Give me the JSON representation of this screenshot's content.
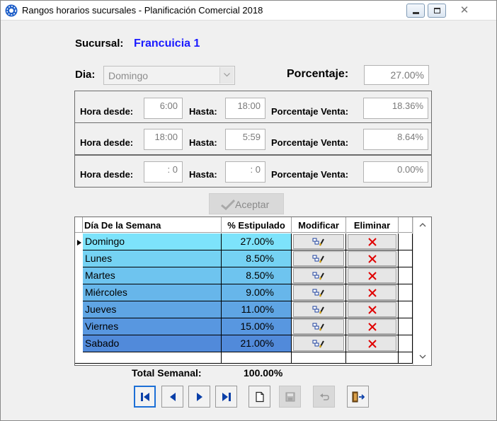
{
  "window": {
    "title": "Rangos horarios sucursales  -  Planificación Comercial 2018",
    "close_glyph": "✕"
  },
  "branch": {
    "label": "Sucursal:",
    "value": "Francuicia 1"
  },
  "day": {
    "label": "Dia:",
    "value": "Domingo"
  },
  "percentage": {
    "label": "Porcentaje:",
    "value": "27.00%"
  },
  "ranges": [
    {
      "from_label": "Hora desde:",
      "from": "6:00",
      "to_label": "Hasta:",
      "to": "18:00",
      "pct_label": "Porcentaje Venta:",
      "pct": "18.36%"
    },
    {
      "from_label": "Hora desde:",
      "from": "18:00",
      "to_label": "Hasta:",
      "to": "5:59",
      "pct_label": "Porcentaje Venta:",
      "pct": "8.64%"
    },
    {
      "from_label": "Hora desde:",
      "from": ": 0",
      "to_label": "Hasta:",
      "to": ": 0",
      "pct_label": "Porcentaje Venta:",
      "pct": "0.00%"
    }
  ],
  "accept_label": "Aceptar",
  "table": {
    "columns": [
      "Día De la Semana",
      "% Estipulado",
      "Modificar",
      "Eliminar"
    ],
    "rows": [
      {
        "day": "Domingo",
        "pct": "27.00%",
        "color": "#7de3fb"
      },
      {
        "day": "Lunes",
        "pct": "8.50%",
        "color": "#75d2f3"
      },
      {
        "day": "Martes",
        "pct": "8.50%",
        "color": "#6ec4ef"
      },
      {
        "day": "Miércoles",
        "pct": "9.00%",
        "color": "#67b6ea"
      },
      {
        "day": "Jueves",
        "pct": "11.00%",
        "color": "#5fa5e4"
      },
      {
        "day": "Viernes",
        "pct": "15.00%",
        "color": "#5897e0"
      },
      {
        "day": "Sabado",
        "pct": "21.00%",
        "color": "#518ada"
      }
    ]
  },
  "total": {
    "label": "Total Semanal:",
    "value": "100.00%"
  },
  "icons": [
    "first-record-icon",
    "previous-record-icon",
    "next-record-icon",
    "last-record-icon",
    "new-document-icon",
    "save-icon",
    "undo-icon",
    "exit-icon"
  ],
  "colors": {
    "accent_blue": "#1a1aff",
    "nav_blue": "#0a3fa8",
    "delete_red": "#e00000"
  }
}
